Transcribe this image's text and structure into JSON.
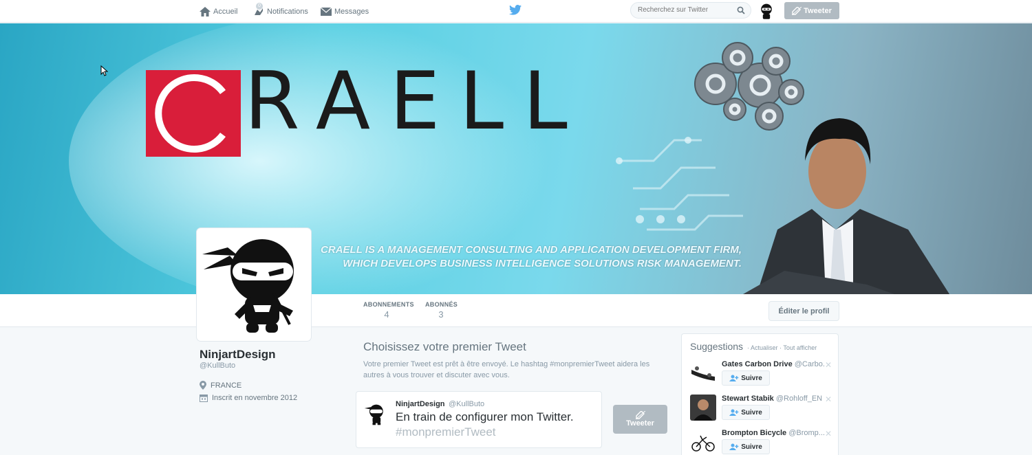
{
  "nav": {
    "home": "Accueil",
    "notifications": "Notifications",
    "notifications_count": "0",
    "messages": "Messages",
    "search_placeholder": "Recherchez sur Twitter",
    "tweet_button": "Tweeter"
  },
  "banner": {
    "logo_text": "RAELL",
    "tagline_1": "CRAELL IS A MANAGEMENT CONSULTING AND APPLICATION DEVELOPMENT FIRM,",
    "tagline_2": "WHICH DEVELOPS BUSINESS INTELLIGENCE SOLUTIONS RISK MANAGEMENT."
  },
  "profile": {
    "name": "NinjartDesign",
    "handle": "@KullButo",
    "location": "FRANCE",
    "joined": "Inscrit en novembre 2012",
    "stats": [
      {
        "label": "ABONNEMENTS",
        "value": "4"
      },
      {
        "label": "ABONNÉS",
        "value": "3"
      }
    ],
    "edit_button": "Éditer le profil"
  },
  "first_tweet": {
    "title": "Choisissez votre premier Tweet",
    "description": "Votre premier Tweet est prêt à être envoyé. Le hashtag #monpremierTweet aidera les autres à vous trouver et discuter avec vous.",
    "author_name": "NinjartDesign",
    "author_handle": "@KullButo",
    "text": "En train de configurer mon Twitter.",
    "hashtag": "#monpremierTweet",
    "button": "Tweeter"
  },
  "suggestions": {
    "title": "Suggestions",
    "refresh": "Actualiser",
    "separator": "·",
    "view_all": "Tout afficher",
    "follow_label": "Suivre",
    "items": [
      {
        "name": "Gates Carbon Drive",
        "handle": "@Carbo..."
      },
      {
        "name": "Stewart Stabik",
        "handle": "@Rohloff_EN"
      },
      {
        "name": "Brompton Bicycle",
        "handle": "@Bromp..."
      }
    ]
  },
  "colors": {
    "accent": "#55acee",
    "button_disabled": "#b1bbc2",
    "brand_red": "#d91e3a"
  }
}
